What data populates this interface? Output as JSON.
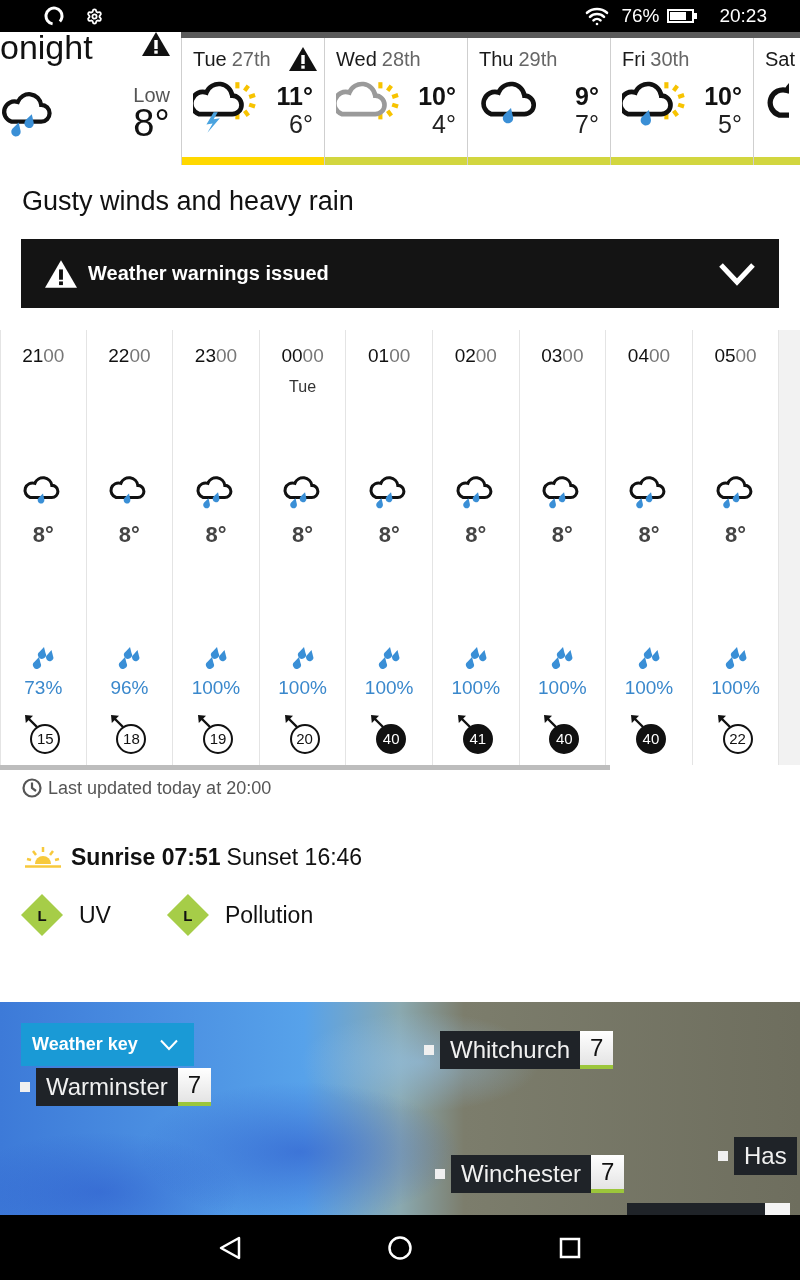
{
  "status_bar": {
    "battery": "76%",
    "time": "20:23"
  },
  "days": [
    {
      "selected": true,
      "kind": "heavy-rain",
      "weekday": "onight",
      "warning": true,
      "low_label": "Low",
      "low": "8°"
    },
    {
      "selected": false,
      "kind": "thunder-sun",
      "weekday": "Tue",
      "date": "27th",
      "warning": true,
      "high": "11°",
      "low": "6°",
      "color": "#ffd800"
    },
    {
      "selected": false,
      "kind": "cloud-sun",
      "weekday": "Wed",
      "date": "28th",
      "warning": false,
      "high": "10°",
      "low": "4°",
      "color": "#d2d63f"
    },
    {
      "selected": false,
      "kind": "light-rain",
      "weekday": "Thu",
      "date": "29th",
      "warning": false,
      "high": "9°",
      "low": "7°",
      "color": "#d2d63f"
    },
    {
      "selected": false,
      "kind": "rain-sun",
      "weekday": "Fri",
      "date": "30th",
      "warning": false,
      "high": "10°",
      "low": "5°",
      "color": "#d2d63f"
    },
    {
      "selected": false,
      "kind": "light-rain",
      "weekday": "Sat",
      "warning": false,
      "color": "#d2d63f"
    }
  ],
  "summary": "Gusty winds and heavy rain",
  "warning_banner": {
    "label": "Weather warnings issued",
    "expanded": false
  },
  "hours": [
    {
      "hour": "21",
      "minutes": "00",
      "kind": "light-rain",
      "temperature": "8°",
      "precipitation": "73%",
      "wind": "15",
      "strong": false
    },
    {
      "hour": "22",
      "minutes": "00",
      "kind": "light-rain",
      "temperature": "8°",
      "precipitation": "96%",
      "wind": "18",
      "strong": false
    },
    {
      "hour": "23",
      "minutes": "00",
      "kind": "heavy-rain",
      "temperature": "8°",
      "precipitation": "100%",
      "wind": "19",
      "strong": false
    },
    {
      "hour": "00",
      "minutes": "00",
      "day": "Tue",
      "kind": "heavy-rain",
      "temperature": "8°",
      "precipitation": "100%",
      "wind": "20",
      "strong": false
    },
    {
      "hour": "01",
      "minutes": "00",
      "kind": "heavy-rain",
      "temperature": "8°",
      "precipitation": "100%",
      "wind": "40",
      "strong": true
    },
    {
      "hour": "02",
      "minutes": "00",
      "kind": "heavy-rain",
      "temperature": "8°",
      "precipitation": "100%",
      "wind": "41",
      "strong": true
    },
    {
      "hour": "03",
      "minutes": "00",
      "kind": "heavy-rain",
      "temperature": "8°",
      "precipitation": "100%",
      "wind": "40",
      "strong": true
    },
    {
      "hour": "04",
      "minutes": "00",
      "kind": "heavy-rain",
      "temperature": "8°",
      "precipitation": "100%",
      "wind": "40",
      "strong": true
    },
    {
      "hour": "05",
      "minutes": "00",
      "kind": "heavy-rain",
      "temperature": "8°",
      "precipitation": "100%",
      "wind": "22",
      "strong": false
    }
  ],
  "last_updated": "Last updated today at 20:00",
  "sun": {
    "sunrise": "Sunrise 07:51",
    "sunset": "Sunset 16:46"
  },
  "indices": [
    {
      "rating": "L",
      "label": "UV"
    },
    {
      "rating": "L",
      "label": "Pollution"
    }
  ],
  "map": {
    "key_button": {
      "label": "Weather key",
      "expanded": false
    },
    "places": [
      {
        "name": "Warminster",
        "temperature": "7"
      },
      {
        "name": "Whitchurch",
        "temperature": "7"
      },
      {
        "name": "Winchester",
        "temperature": "7"
      },
      {
        "name": "Has"
      }
    ]
  }
}
